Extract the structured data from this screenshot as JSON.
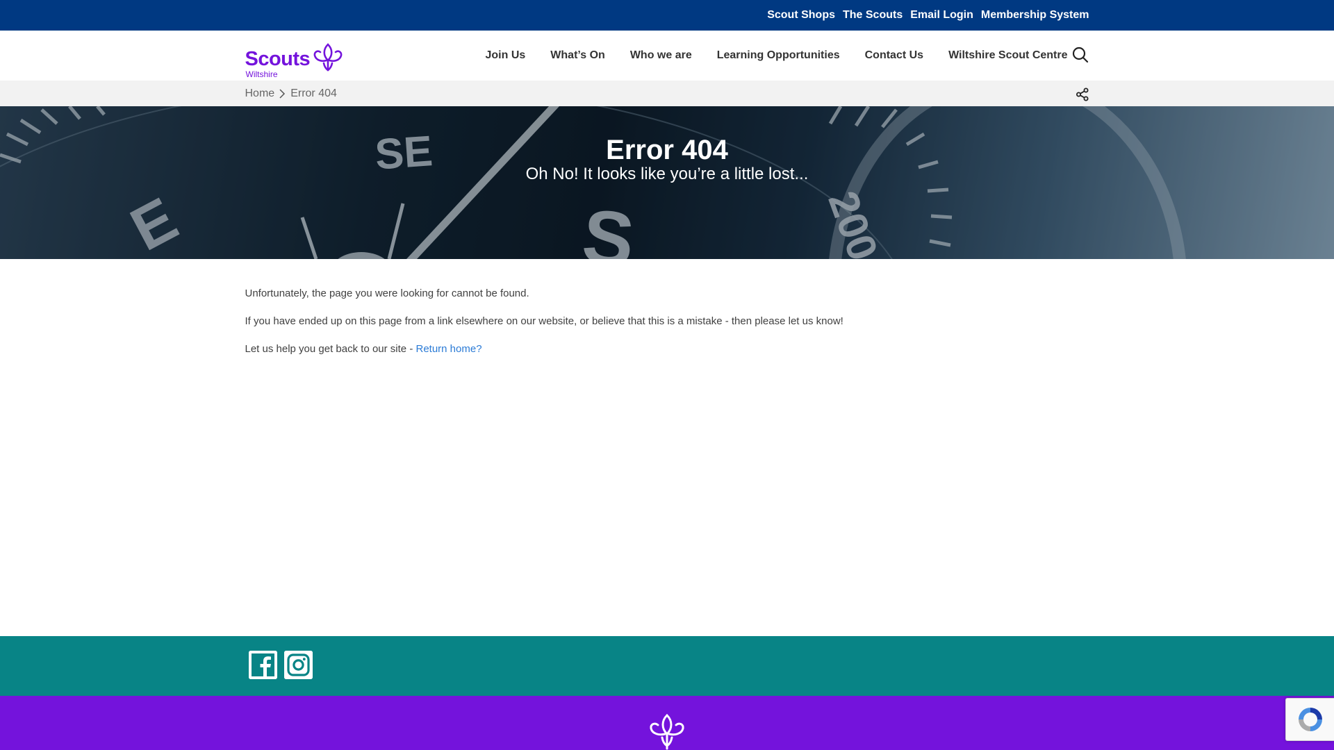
{
  "topbar": {
    "links": [
      "Scout Shops",
      "The Scouts",
      "Email Login",
      "Membership System"
    ]
  },
  "header": {
    "logo_word": "Scouts",
    "logo_sub": "Wiltshire",
    "nav": [
      "Join Us",
      "What’s On",
      "Who we are",
      "Learning Opportunities",
      "Contact Us",
      "Wiltshire Scout Centre"
    ],
    "search_icon": "search-icon"
  },
  "breadcrumb": {
    "home": "Home",
    "current": "Error 404",
    "share_icon": "share-icon"
  },
  "hero": {
    "title": "Error 404",
    "subtitle": "Oh No! It looks like you’re a little lost..."
  },
  "content": {
    "line1": "Unfortunately, the page you were looking for cannot be found.",
    "line2": "If you have ended up on this page from a link elsewhere on our website, or believe that this is a mistake - then please let us know!",
    "line3_prefix": "Let us help you get back to our site - ",
    "line3_link": "Return home?"
  },
  "footer": {
    "social": [
      "facebook-icon",
      "instagram-icon"
    ]
  },
  "colors": {
    "topbar": "#003982",
    "brand_purple": "#7413dc",
    "footer_teal": "#088486",
    "link_blue": "#2b7bd6"
  }
}
